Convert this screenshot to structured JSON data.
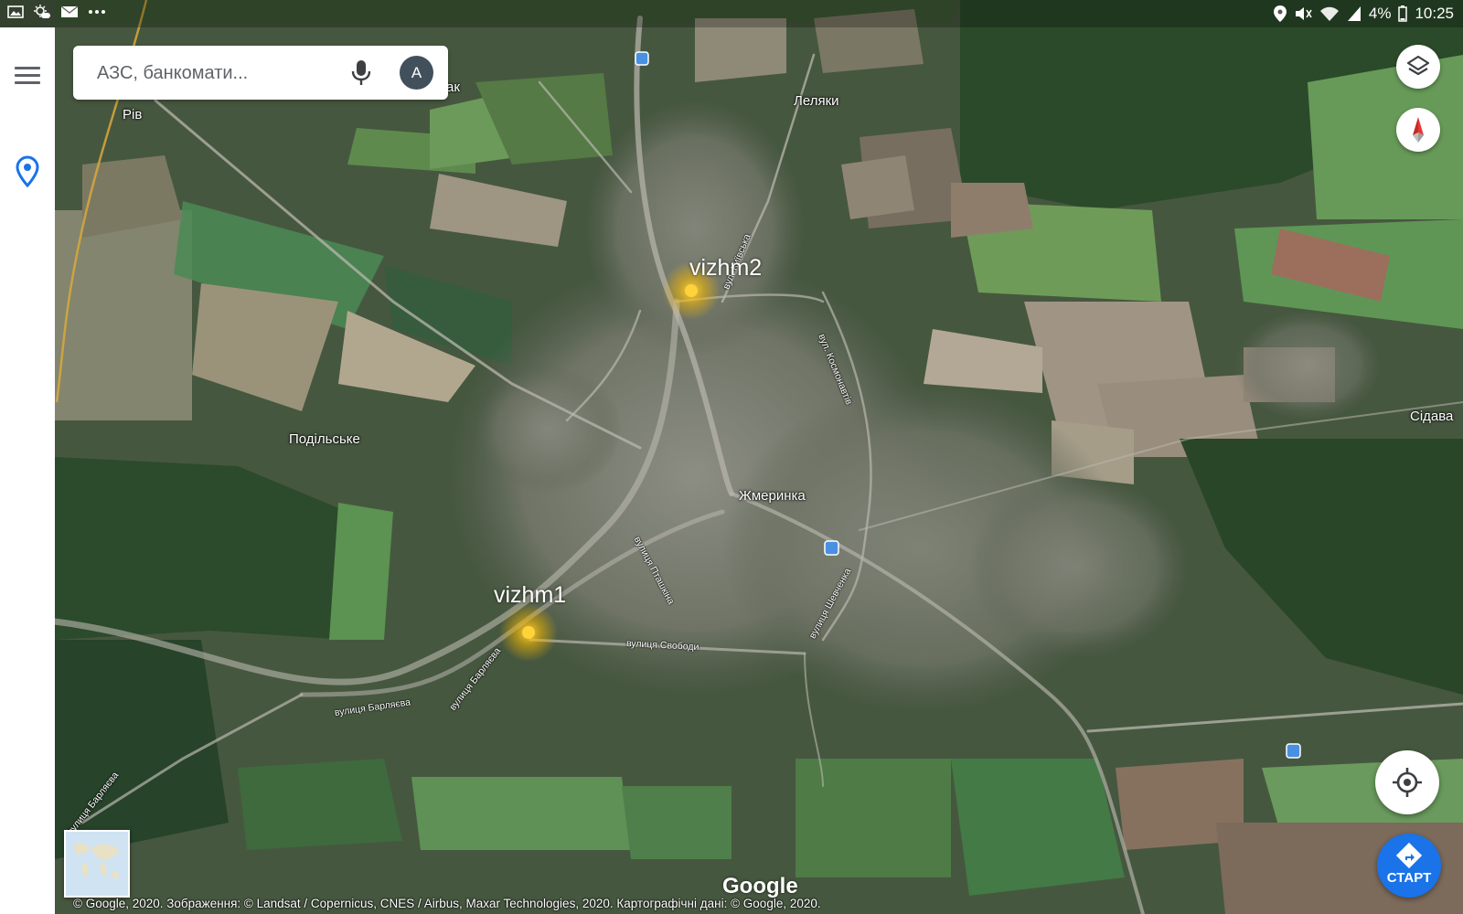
{
  "status_bar": {
    "battery": "4%",
    "time": "10:25",
    "left_icons": [
      "gallery-icon",
      "weather-icon",
      "mail-icon",
      "more-dots-icon"
    ],
    "right_icons": [
      "location-icon",
      "mute-icon",
      "wifi-icon",
      "signal-icon",
      "battery-icon"
    ]
  },
  "search": {
    "placeholder": "АЗС, банкомати...",
    "avatar_letter": "A"
  },
  "markers": [
    {
      "label": "vizhm2"
    },
    {
      "label": "vizhm1"
    }
  ],
  "places": {
    "lelyaky": "Леляки",
    "rov": "Рів",
    "podilske": "Подільське",
    "zhmerynka": "Жмеринка",
    "sidava": "Сідава",
    "ak": "ак"
  },
  "streets": {
    "svobody": "вулиця Свободи",
    "barliaieva1": "вулиця Барляєва",
    "barliaieva2": "вулиця Барляєва",
    "barliaieva3": "вулиця Барляєва",
    "ptashkina": "вулиця Пташкіна",
    "shevchenka": "вулиця Шевченка",
    "kosmonavtiv": "вул. Космонавтів",
    "kyivska": "вул. Київська"
  },
  "controls": {
    "start_label": "СТАРТ",
    "layers_icon": "layers-icon",
    "compass_icon": "compass-icon",
    "my_location_icon": "my-location-icon",
    "directions_icon": "directions-icon"
  },
  "footer": {
    "google_logo": "Google",
    "attribution": "© Google, 2020. Зображення: © Landsat / Copernicus, CNES / Airbus, Maxar Technologies, 2020. Картографічні дані: © Google, 2020."
  },
  "colors": {
    "accent": "#1a73e8",
    "marker": "#f7c21a",
    "avatar_bg": "#41505b"
  }
}
